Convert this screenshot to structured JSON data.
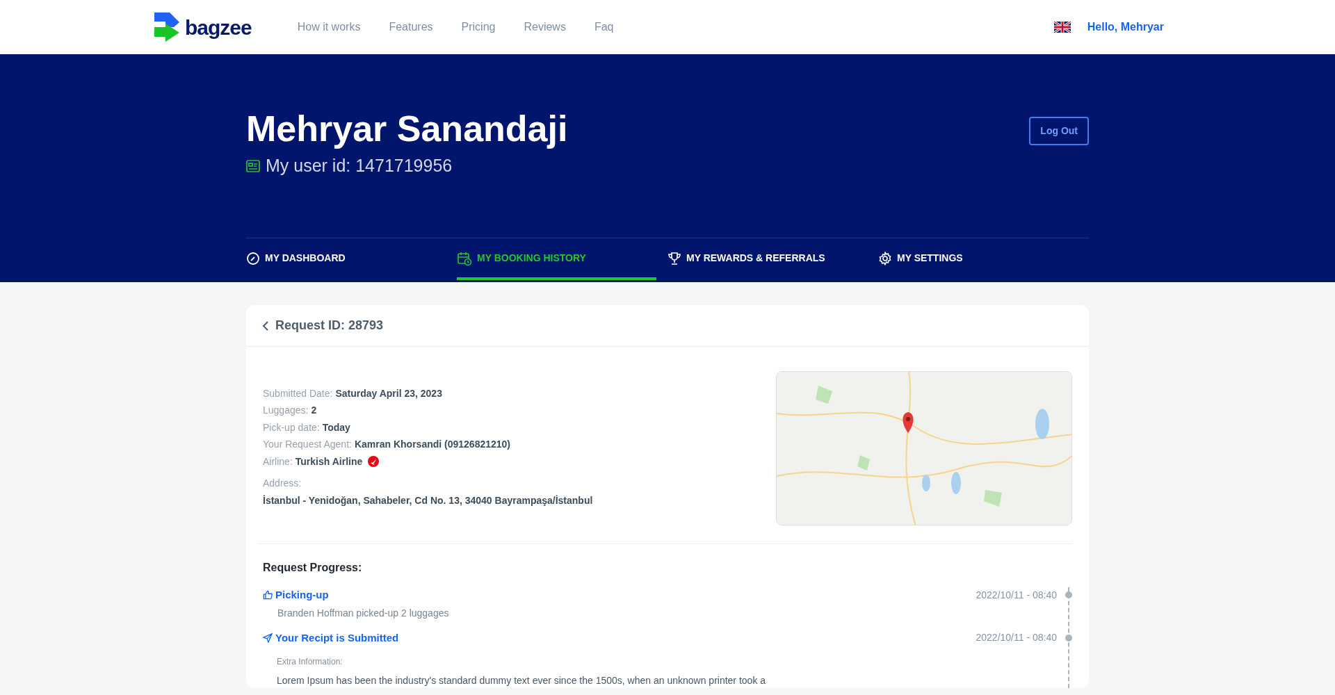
{
  "nav": {
    "brand": "bagzee",
    "links": [
      "How it works",
      "Features",
      "Pricing",
      "Reviews",
      "Faq"
    ],
    "greeting": "Hello, Mehryar"
  },
  "profile": {
    "name": "Mehryar Sanandaji",
    "user_id": "My user id: 1471719956",
    "logout": "Log Out"
  },
  "tabs": [
    {
      "label": "MY DASHBOARD",
      "kind": "gauge",
      "selected": false
    },
    {
      "label": "MY BOOKING HISTORY",
      "kind": "calendar",
      "selected": true
    },
    {
      "label": "MY REWARDS & REFERRALS",
      "kind": "trophy",
      "selected": false
    },
    {
      "label": "MY SETTINGS",
      "kind": "gear",
      "selected": false
    }
  ],
  "request": {
    "title": "Request ID: 28793",
    "details": [
      {
        "label": "Submitted Date:",
        "value": "Saturday April 23, 2023",
        "kind": "text"
      },
      {
        "label": "Luggages:",
        "value": "2",
        "kind": "text"
      },
      {
        "label": "Pick-up date:",
        "value": "Today",
        "kind": "text"
      },
      {
        "label": "Your Request Agent:",
        "value": "Kamran Khorsandi (09126821210)",
        "kind": "text"
      },
      {
        "label": "Airline:",
        "value": "Turkish Airline",
        "kind": "airline"
      }
    ],
    "address": {
      "label": "Address:",
      "value": "İstanbul - Yenidoğan, Sahabeler, Cd No. 13, 34040 Bayrampaşa/İstanbul"
    }
  },
  "progress": {
    "title": "Request Progress:",
    "steps": [
      {
        "kind": "thumb",
        "title": "Picking-up",
        "time": "2022/10/11 - 08:40",
        "note": "Branden Hoffman picked-up 2 luggages"
      },
      {
        "kind": "send",
        "title": "Your Recipt is Submitted",
        "time": "2022/10/11 - 08:40",
        "extra_label": "Extra Information:",
        "extra_text": "Lorem Ipsum has been the industry's standard dummy text ever since the 1500s, when an unknown printer took a"
      }
    ]
  }
}
